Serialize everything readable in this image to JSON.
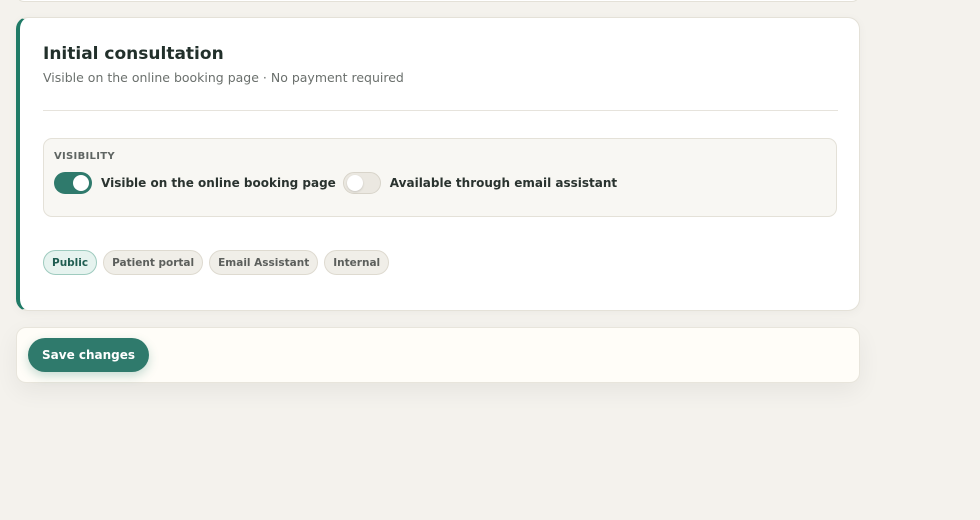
{
  "service": {
    "title": "Initial consultation",
    "subtitle": "Visible on the online booking page · No payment required"
  },
  "visibility": {
    "label": "VISIBILITY",
    "toggles": [
      {
        "label": "Visible on the online booking page",
        "on": true
      },
      {
        "label": "Available through email assistant",
        "on": false
      }
    ]
  },
  "tags": [
    {
      "label": "Public",
      "active": true
    },
    {
      "label": "Patient portal",
      "active": false
    },
    {
      "label": "Email Assistant",
      "active": false
    },
    {
      "label": "Internal",
      "active": false
    }
  ],
  "footer": {
    "save_label": "Save changes"
  },
  "colors": {
    "accent": "#1f7a66",
    "toggle_on": "#2f7a6c",
    "background": "#f4f2ed"
  }
}
